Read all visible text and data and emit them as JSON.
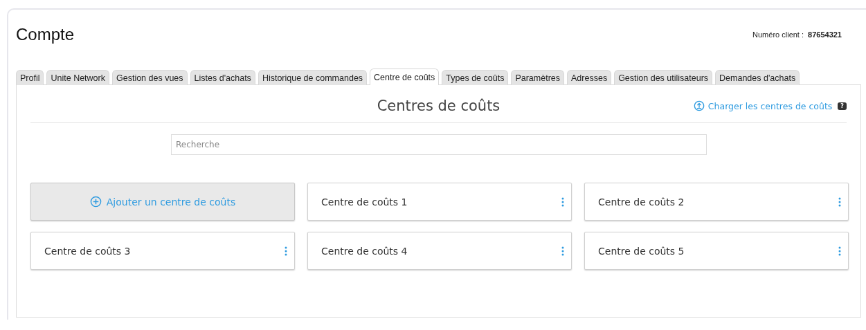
{
  "page": {
    "title": "Compte",
    "client_label": "Numéro client :",
    "client_number": "87654321"
  },
  "tabs": [
    {
      "label": "Profil",
      "selected": false
    },
    {
      "label": "Unite Network",
      "selected": false
    },
    {
      "label": "Gestion des vues",
      "selected": false
    },
    {
      "label": "Listes d'achats",
      "selected": false
    },
    {
      "label": "Historique de commandes",
      "selected": false
    },
    {
      "label": "Centre de coûts",
      "selected": true
    },
    {
      "label": "Types de coûts",
      "selected": false
    },
    {
      "label": "Paramètres",
      "selected": false
    },
    {
      "label": "Adresses",
      "selected": false
    },
    {
      "label": "Gestion des utilisateurs",
      "selected": false
    },
    {
      "label": "Demandes d'achats",
      "selected": false
    }
  ],
  "panel": {
    "title": "Centres de coûts",
    "upload_link": "Charger les centres de coûts",
    "help_badge": "?",
    "search": {
      "placeholder": "Recherche"
    }
  },
  "cards": [
    {
      "kind": "add",
      "label": "Ajouter un centre de coûts"
    },
    {
      "kind": "item",
      "label": "Centre de coûts 1"
    },
    {
      "kind": "item",
      "label": "Centre de coûts 2"
    },
    {
      "kind": "item",
      "label": "Centre de coûts 3"
    },
    {
      "kind": "item",
      "label": "Centre de coûts 4"
    },
    {
      "kind": "item",
      "label": "Centre de coûts 5"
    }
  ]
}
